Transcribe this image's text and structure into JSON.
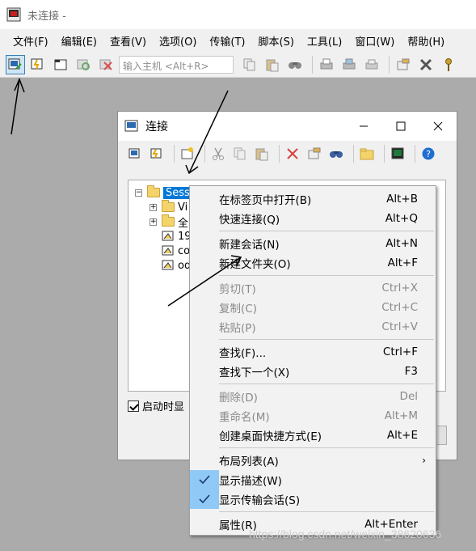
{
  "window": {
    "title": "未连接 -"
  },
  "menubar": {
    "items": [
      "文件(F)",
      "编辑(E)",
      "查看(V)",
      "选项(O)",
      "传输(T)",
      "脚本(S)",
      "工具(L)",
      "窗口(W)",
      "帮助(H)"
    ]
  },
  "toolbar": {
    "host_placeholder": "输入主机 <Alt+R>",
    "icons": [
      "connect-icon",
      "quick-connect-icon",
      "connect-tab-icon",
      "reconnect-icon",
      "disconnect-icon",
      "copy-icon",
      "paste-icon",
      "find-icon",
      "print-icon",
      "print-screen-icon",
      "print-setup-icon",
      "settings-icon",
      "tools-icon",
      "key-icon"
    ]
  },
  "dialog": {
    "title": "连接",
    "tree": {
      "root": "Sessions",
      "children": [
        "Vi",
        "全",
        "19",
        "co",
        "od"
      ]
    },
    "startup_checkbox": "启动时显"
  },
  "context_menu": {
    "items": [
      {
        "label": "在标签页中打开(B)",
        "shortcut": "Alt+B",
        "disabled": false,
        "checked": false
      },
      {
        "label": "快速连接(Q)",
        "shortcut": "Alt+Q",
        "disabled": false,
        "checked": false
      },
      {
        "label": "新建会话(N)",
        "shortcut": "Alt+N",
        "disabled": false,
        "checked": false
      },
      {
        "label": "新建文件夹(O)",
        "shortcut": "Alt+F",
        "disabled": false,
        "checked": false
      },
      {
        "label": "剪切(T)",
        "shortcut": "Ctrl+X",
        "disabled": true,
        "checked": false
      },
      {
        "label": "复制(C)",
        "shortcut": "Ctrl+C",
        "disabled": true,
        "checked": false
      },
      {
        "label": "粘贴(P)",
        "shortcut": "Ctrl+V",
        "disabled": true,
        "checked": false
      },
      {
        "label": "查找(F)...",
        "shortcut": "Ctrl+F",
        "disabled": false,
        "checked": false
      },
      {
        "label": "查找下一个(X)",
        "shortcut": "F3",
        "disabled": false,
        "checked": false
      },
      {
        "label": "删除(D)",
        "shortcut": "Del",
        "disabled": true,
        "checked": false
      },
      {
        "label": "重命名(M)",
        "shortcut": "Alt+M",
        "disabled": true,
        "checked": false
      },
      {
        "label": "创建桌面快捷方式(E)",
        "shortcut": "Alt+E",
        "disabled": false,
        "checked": false
      },
      {
        "label": "布局列表(A)",
        "shortcut": "",
        "disabled": false,
        "checked": false,
        "submenu": true
      },
      {
        "label": "显示描述(W)",
        "shortcut": "",
        "disabled": false,
        "checked": true
      },
      {
        "label": "显示传输会话(S)",
        "shortcut": "",
        "disabled": false,
        "checked": true
      },
      {
        "label": "属性(R)",
        "shortcut": "Alt+Enter",
        "disabled": false,
        "checked": false
      }
    ]
  },
  "watermark": "https://blog.csdn.net/weixin_38620636",
  "colors": {
    "selection": "#0078d7",
    "checked_bg": "#90c8f6",
    "active_button": "#cde6f7"
  }
}
